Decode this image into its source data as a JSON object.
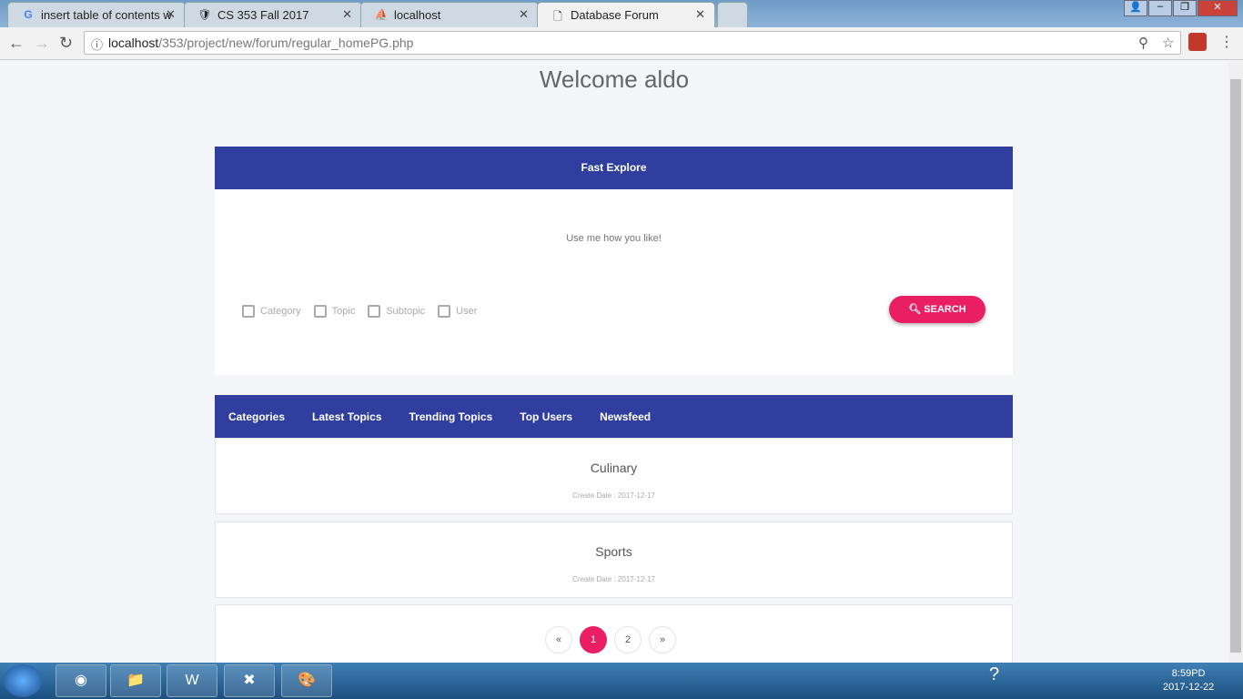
{
  "browser": {
    "tabs": [
      {
        "title": "insert table of contents w",
        "icon": "google-icon"
      },
      {
        "title": "CS 353 Fall 2017",
        "icon": "shield-icon"
      },
      {
        "title": "localhost",
        "icon": "phpmyadmin-icon"
      },
      {
        "title": "Database Forum",
        "icon": "page-icon",
        "active": true
      }
    ],
    "url_host": "localhost",
    "url_path": "/353/project/new/forum/regular_homePG.php"
  },
  "page": {
    "welcome": "Welcome aldo",
    "fast_explore": {
      "title": "Fast Explore",
      "placeholder": "Use me how you like!",
      "checkboxes": [
        {
          "label": "Category",
          "checked": false
        },
        {
          "label": "Topic",
          "checked": false
        },
        {
          "label": "Subtopic",
          "checked": false
        },
        {
          "label": "User",
          "checked": false
        }
      ],
      "search_label": "SEARCH"
    },
    "nav_tabs": [
      "Categories",
      "Latest Topics",
      "Trending Topics",
      "Top Users",
      "Newsfeed"
    ],
    "items": [
      {
        "title": "Culinary",
        "date": "Create Date : 2017-12-17"
      },
      {
        "title": "Sports",
        "date": "Create Date : 2017-12-17"
      }
    ],
    "pagination": {
      "prev": "«",
      "pages": [
        "1",
        "2"
      ],
      "current": "1",
      "next": "»"
    }
  },
  "colors": {
    "primary": "#303f9f",
    "accent": "#e91e63"
  },
  "taskbar": {
    "time": "8:59PD",
    "date": "2017-12-22"
  }
}
